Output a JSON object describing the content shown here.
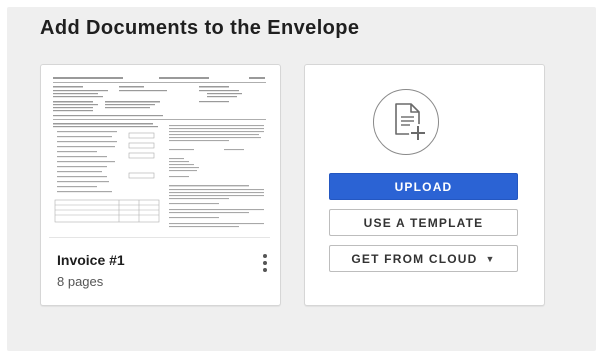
{
  "heading": "Add Documents to the Envelope",
  "document": {
    "name": "Invoice #1",
    "pages": "8 pages",
    "menu_icon": "more-vertical-icon"
  },
  "add_panel": {
    "icon": "add-document-icon",
    "upload_label": "UPLOAD",
    "template_label": "USE A TEMPLATE",
    "cloud_label": "GET FROM CLOUD",
    "cloud_caret_icon": "caret-down-icon"
  },
  "colors": {
    "panel_bg": "#efefef",
    "primary": "#2b63d4"
  }
}
